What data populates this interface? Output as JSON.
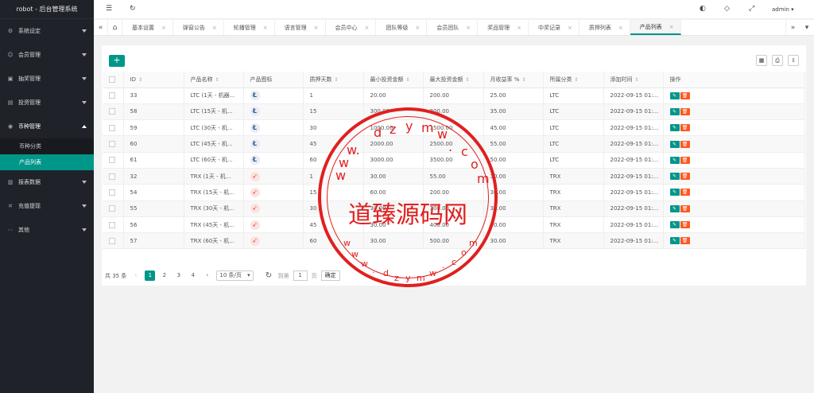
{
  "app_title": "robot - 后台管理系统",
  "header": {
    "user": "admin"
  },
  "sidebar": {
    "items": [
      {
        "label": "系统设定"
      },
      {
        "label": "会员管理"
      },
      {
        "label": "抽奖管理"
      },
      {
        "label": "投资管理"
      },
      {
        "label": "币种管理"
      },
      {
        "label": "报表数据"
      },
      {
        "label": "充值提现"
      },
      {
        "label": "其他"
      }
    ],
    "sub_items": [
      {
        "label": "币种分类"
      },
      {
        "label": "产品列表"
      }
    ]
  },
  "tabs": [
    {
      "label": "基本设置"
    },
    {
      "label": "弹窗公告"
    },
    {
      "label": "轮播管理"
    },
    {
      "label": "语言管理"
    },
    {
      "label": "会员中心"
    },
    {
      "label": "团队等级"
    },
    {
      "label": "会员团队"
    },
    {
      "label": "奖品管理"
    },
    {
      "label": "中奖记录"
    },
    {
      "label": "质押列表"
    },
    {
      "label": "产品列表"
    }
  ],
  "table": {
    "headers": [
      "ID",
      "产品名称",
      "产品图标",
      "质押天数",
      "最小投资金额",
      "最大投资金额",
      "月收益率 %",
      "所属分类",
      "添加时间",
      "操作"
    ],
    "rows": [
      {
        "id": "33",
        "name": "LTC (1天 - 机器...",
        "icon": "ltc",
        "days": "1",
        "min": "20.00",
        "max": "200.00",
        "rate": "25.00",
        "cat": "LTC",
        "time": "2022-09-15 01:..."
      },
      {
        "id": "58",
        "name": "LTC (15天 - 机...",
        "icon": "ltc",
        "days": "15",
        "min": "300.00",
        "max": "800.00",
        "rate": "35.00",
        "cat": "LTC",
        "time": "2022-09-15 01:..."
      },
      {
        "id": "59",
        "name": "LTC (30天 - 机...",
        "icon": "ltc",
        "days": "30",
        "min": "1000.00",
        "max": "1500.00",
        "rate": "45.00",
        "cat": "LTC",
        "time": "2022-09-15 01:..."
      },
      {
        "id": "60",
        "name": "LTC (45天 - 机...",
        "icon": "ltc",
        "days": "45",
        "min": "2000.00",
        "max": "2500.00",
        "rate": "55.00",
        "cat": "LTC",
        "time": "2022-09-15 01:..."
      },
      {
        "id": "61",
        "name": "LTC (60天 - 机...",
        "icon": "ltc",
        "days": "60",
        "min": "3000.00",
        "max": "3500.00",
        "rate": "50.00",
        "cat": "LTC",
        "time": "2022-09-15 01:..."
      },
      {
        "id": "32",
        "name": "TRX (1天 - 机...",
        "icon": "trx",
        "days": "1",
        "min": "30.00",
        "max": "55.00",
        "rate": "30.00",
        "cat": "TRX",
        "time": "2022-09-15 01:..."
      },
      {
        "id": "54",
        "name": "TRX (15天 - 机...",
        "icon": "trx",
        "days": "15",
        "min": "60.00",
        "max": "200.00",
        "rate": "30.00",
        "cat": "TRX",
        "time": "2022-09-15 01:..."
      },
      {
        "id": "55",
        "name": "TRX (30天 - 机...",
        "icon": "trx",
        "days": "30",
        "min": "30.00",
        "max": "300.00",
        "rate": "30.00",
        "cat": "TRX",
        "time": "2022-09-15 01:..."
      },
      {
        "id": "56",
        "name": "TRX (45天 - 机...",
        "icon": "trx",
        "days": "45",
        "min": "30.00",
        "max": "400.00",
        "rate": "30.00",
        "cat": "TRX",
        "time": "2022-09-15 01:..."
      },
      {
        "id": "57",
        "name": "TRX (60天 - 机...",
        "icon": "trx",
        "days": "60",
        "min": "30.00",
        "max": "500.00",
        "rate": "30.00",
        "cat": "TRX",
        "time": "2022-09-15 01:..."
      }
    ]
  },
  "pager": {
    "total": "共 35 条",
    "pages": [
      "1",
      "2",
      "3",
      "4"
    ],
    "per_page": "10 条/页",
    "goto": "到第",
    "page_input": "1",
    "page_unit": "页",
    "confirm": "确定"
  },
  "watermark": {
    "text": "道臻源码网"
  },
  "colors": {
    "primary": "#009688",
    "danger": "#ff5722",
    "sidebar": "#20222a",
    "watermark": "#e0201f"
  }
}
